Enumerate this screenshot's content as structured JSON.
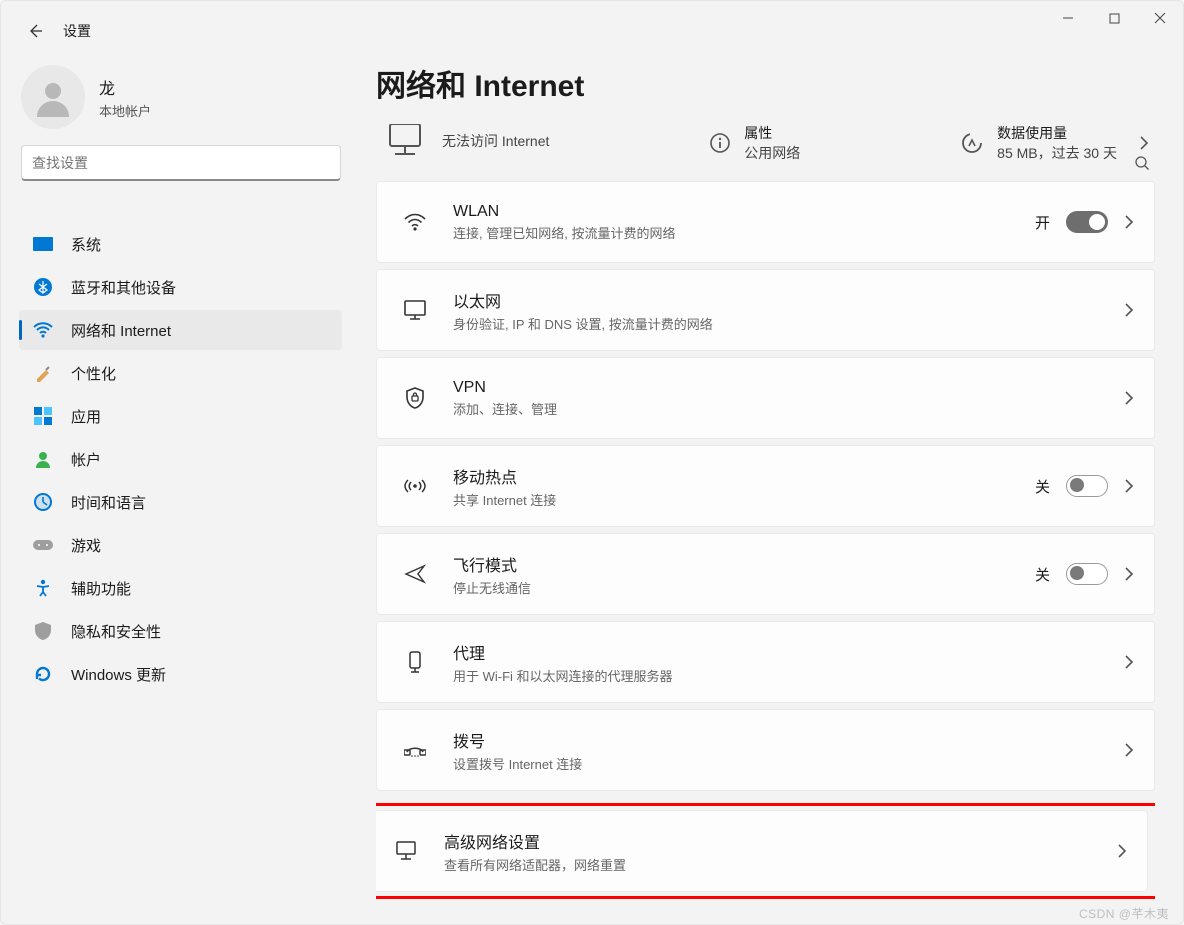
{
  "window": {
    "app_title": "设置",
    "user_name": "龙",
    "user_type": "本地帐户"
  },
  "search": {
    "placeholder": "查找设置"
  },
  "sidebar": {
    "items": [
      {
        "label": "系统",
        "icon": "system-icon"
      },
      {
        "label": "蓝牙和其他设备",
        "icon": "bluetooth-icon"
      },
      {
        "label": "网络和 Internet",
        "icon": "wifi-icon",
        "active": true
      },
      {
        "label": "个性化",
        "icon": "personalize-icon"
      },
      {
        "label": "应用",
        "icon": "apps-icon"
      },
      {
        "label": "帐户",
        "icon": "accounts-icon"
      },
      {
        "label": "时间和语言",
        "icon": "time-icon"
      },
      {
        "label": "游戏",
        "icon": "gaming-icon"
      },
      {
        "label": "辅助功能",
        "icon": "accessibility-icon"
      },
      {
        "label": "隐私和安全性",
        "icon": "privacy-icon"
      },
      {
        "label": "Windows 更新",
        "icon": "update-icon"
      }
    ]
  },
  "page": {
    "title": "网络和 Internet",
    "status": {
      "connection_line": "无法访问 Internet",
      "props_title": "属性",
      "props_sub": "公用网络",
      "usage_title": "数据使用量",
      "usage_sub": "85 MB，过去 30 天"
    },
    "cards": [
      {
        "id": "wlan",
        "title": "WLAN",
        "sub": "连接, 管理已知网络, 按流量计费的网络",
        "toggleLabel": "开",
        "toggle": "on"
      },
      {
        "id": "ethernet",
        "title": "以太网",
        "sub": "身份验证, IP 和 DNS 设置, 按流量计费的网络"
      },
      {
        "id": "vpn",
        "title": "VPN",
        "sub": "添加、连接、管理"
      },
      {
        "id": "hotspot",
        "title": "移动热点",
        "sub": "共享 Internet 连接",
        "toggleLabel": "关",
        "toggle": "off"
      },
      {
        "id": "airplane",
        "title": "飞行模式",
        "sub": "停止无线通信",
        "toggleLabel": "关",
        "toggle": "off"
      },
      {
        "id": "proxy",
        "title": "代理",
        "sub": "用于 Wi-Fi 和以太网连接的代理服务器"
      },
      {
        "id": "dialup",
        "title": "拨号",
        "sub": "设置拨号 Internet 连接"
      },
      {
        "id": "advanced",
        "title": "高级网络设置",
        "sub": "查看所有网络适配器，网络重置",
        "highlight": true
      }
    ]
  },
  "watermark": "CSDN @芊木夷"
}
